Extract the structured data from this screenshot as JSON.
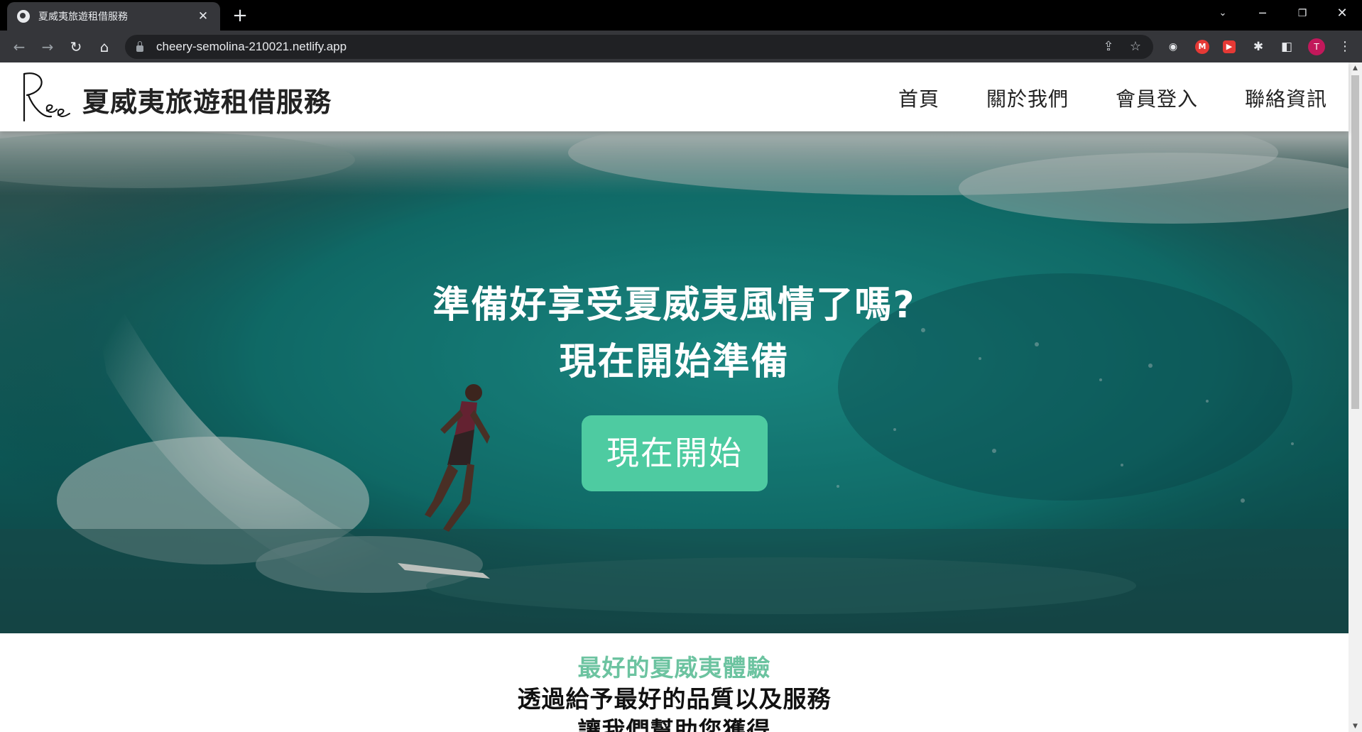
{
  "browser": {
    "tab_title": "夏威夷旅遊租借服務",
    "tab_close": "✕",
    "new_tab": "+",
    "url": "cheery-semolina-210021.netlify.app",
    "profile_initial": "T",
    "ext_m_label": "M",
    "ext_red_label": "▶",
    "icons": [
      "back-icon",
      "forward-icon",
      "reload-icon",
      "home-icon",
      "lock-icon",
      "share-icon",
      "star-icon",
      "extensions-icon",
      "side-panel-icon",
      "menu-icon"
    ]
  },
  "header": {
    "brand": "夏威夷旅遊租借服務",
    "nav": [
      "首頁",
      "關於我們",
      "會員登入",
      "聯絡資訊"
    ]
  },
  "hero": {
    "title_line1": "準備好享受夏威夷風情了嗎?",
    "title_line2": "現在開始準備",
    "cta_label": "現在開始"
  },
  "section": {
    "eyebrow": "最好的夏威夷體驗",
    "line1": "透過給予最好的品質以及服務",
    "line2": "讓我們幫助您獲得"
  },
  "colors": {
    "accent": "#4ecba1",
    "eyebrow": "#6cc3a0",
    "chrome_dark": "#000000",
    "toolbar": "#35363a"
  }
}
